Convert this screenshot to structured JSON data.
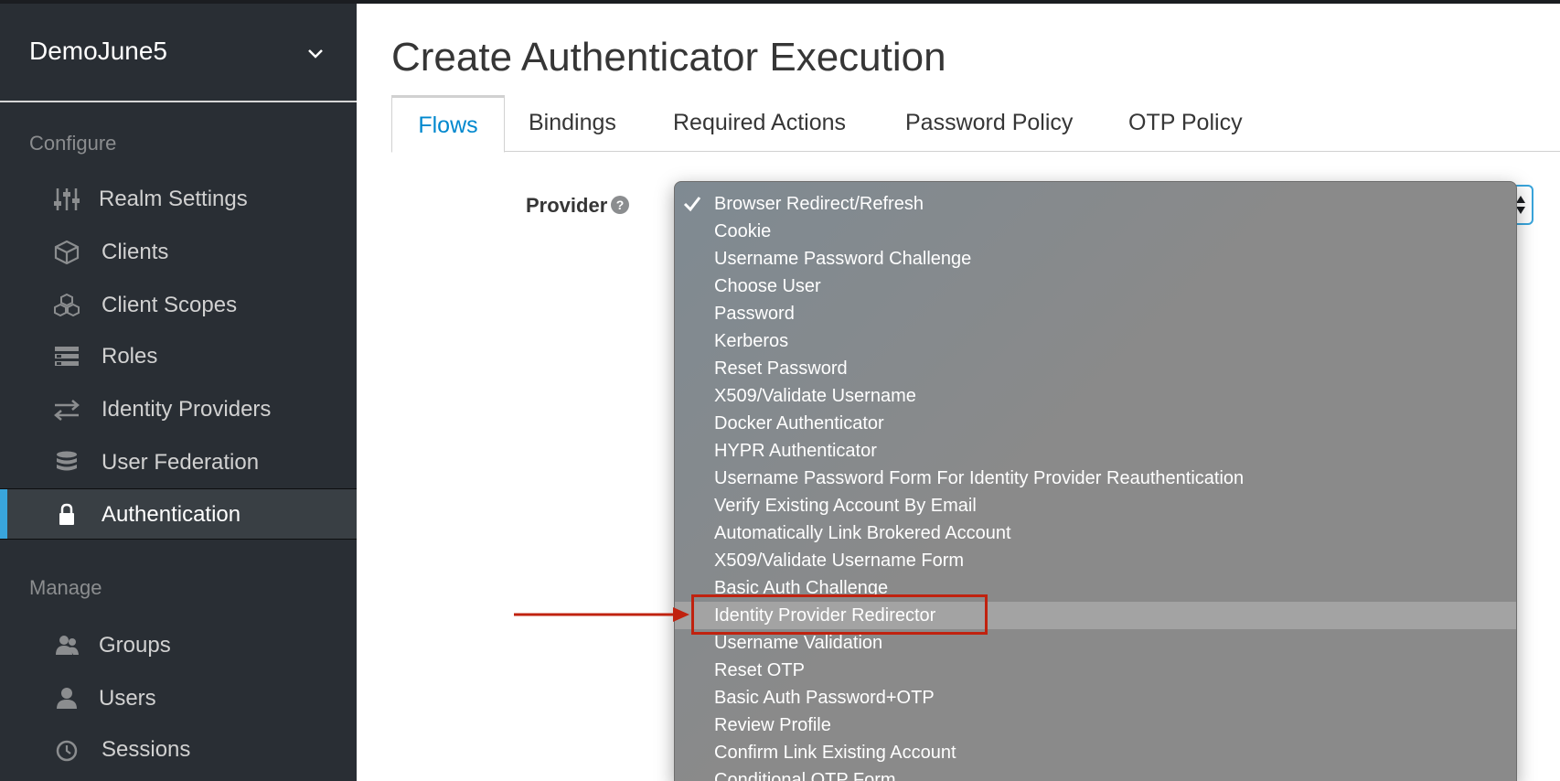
{
  "sidebar": {
    "realm": "DemoJune5",
    "configure_title": "Configure",
    "configure_items": [
      {
        "label": "Realm Settings",
        "icon": "sliders-icon"
      },
      {
        "label": "Clients",
        "icon": "cube-icon"
      },
      {
        "label": "Client Scopes",
        "icon": "cubes-icon"
      },
      {
        "label": "Roles",
        "icon": "list-icon"
      },
      {
        "label": "Identity Providers",
        "icon": "exchange-icon"
      },
      {
        "label": "User Federation",
        "icon": "database-icon"
      },
      {
        "label": "Authentication",
        "icon": "lock-icon",
        "active": true
      }
    ],
    "manage_title": "Manage",
    "manage_items": [
      {
        "label": "Groups",
        "icon": "users-icon"
      },
      {
        "label": "Users",
        "icon": "user-icon"
      },
      {
        "label": "Sessions",
        "icon": "clock-icon"
      }
    ]
  },
  "main": {
    "title": "Create Authenticator Execution",
    "tabs": [
      "Flows",
      "Bindings",
      "Required Actions",
      "Password Policy",
      "OTP Policy"
    ],
    "active_tab": "Flows",
    "provider_label": "Provider",
    "help_glyph": "?"
  },
  "dropdown": {
    "selected": "Browser Redirect/Refresh",
    "highlighted": "Identity Provider Redirector",
    "options": [
      "Browser Redirect/Refresh",
      "Cookie",
      "Username Password Challenge",
      "Choose User",
      "Password",
      "Kerberos",
      "Reset Password",
      "X509/Validate Username",
      "Docker Authenticator",
      "HYPR Authenticator",
      "Username Password Form For Identity Provider Reauthentication",
      "Verify Existing Account By Email",
      "Automatically Link Brokered Account",
      "X509/Validate Username Form",
      "Basic Auth Challenge",
      "Identity Provider Redirector",
      "Username Validation",
      "Reset OTP",
      "Basic Auth Password+OTP",
      "Review Profile",
      "Confirm Link Existing Account",
      "Conditional OTP Form"
    ]
  },
  "colors": {
    "sidebar_bg": "#292e34",
    "accent": "#39a5dc",
    "tab_active": "#0088ce",
    "annotation": "#c0220f"
  }
}
